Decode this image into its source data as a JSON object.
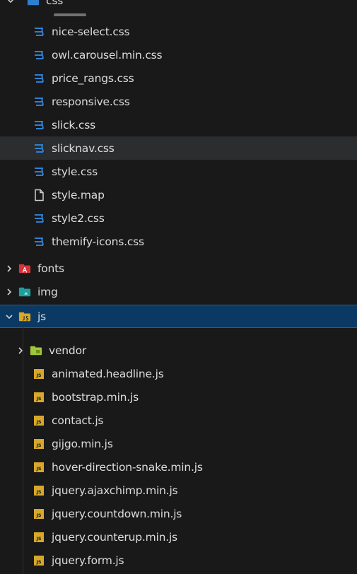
{
  "tree": {
    "top_folder": "css",
    "css_files": [
      "nice-select.css",
      "owl.carousel.min.css",
      "price_rangs.css",
      "responsive.css",
      "slick.css",
      "slicknav.css",
      "style.css",
      "style.map",
      "style2.css",
      "themify-icons.css"
    ],
    "folders": [
      "fonts",
      "img",
      "js"
    ],
    "js_subfolder": "vendor",
    "js_files": [
      "animated.headline.js",
      "bootstrap.min.js",
      "contact.js",
      "gijgo.min.js",
      "hover-direction-snake.min.js",
      "jquery.ajaxchimp.min.js",
      "jquery.countdown.min.js",
      "jquery.counterup.min.js",
      "jquery.form.js"
    ]
  },
  "icons": {
    "css_file": "css-file-icon",
    "map_file": "map-file-icon",
    "js_file": "js-file-icon",
    "folder": "folder-icon",
    "chevron_right": "chevron-right-icon",
    "chevron_down": "chevron-down-icon"
  },
  "colors": {
    "background": "#191919",
    "hover_row": "#2b2d2e",
    "selected_row": "#0a3a64",
    "css_blue": "#2f7fd1",
    "js_yellow": "#d7a82a"
  }
}
